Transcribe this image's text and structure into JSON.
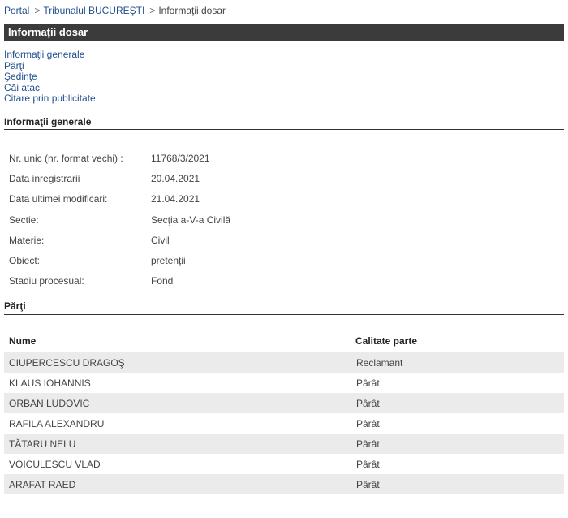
{
  "breadcrumb": {
    "portal": "Portal",
    "sep": ">",
    "court": "Tribunalul BUCUREŞTI",
    "current": "Informaţii dosar"
  },
  "page_title": "Informaţii dosar",
  "anchor_links": [
    "Informaţii generale",
    "Părţi",
    "Şedinţe",
    "Căi atac",
    "Citare prin publicitate"
  ],
  "general": {
    "heading": "Informaţii generale",
    "rows": [
      {
        "label": "Nr. unic (nr. format vechi) :",
        "value": "11768/3/2021"
      },
      {
        "label": "Data inregistrarii",
        "value": "20.04.2021"
      },
      {
        "label": "Data ultimei modificari:",
        "value": "21.04.2021"
      },
      {
        "label": "Sectie:",
        "value": "Secţia a-V-a Civilă"
      },
      {
        "label": "Materie:",
        "value": "Civil"
      },
      {
        "label": "Obiect:",
        "value": "pretenţii"
      },
      {
        "label": "Stadiu procesual:",
        "value": "Fond"
      }
    ]
  },
  "parti": {
    "heading": "Părţi",
    "columns": {
      "name": "Nume",
      "role": "Calitate parte"
    },
    "rows": [
      {
        "name": "CIUPERCESCU DRAGOŞ",
        "role": "Reclamant"
      },
      {
        "name": "KLAUS IOHANNIS",
        "role": "Pârât"
      },
      {
        "name": "ORBAN LUDOVIC",
        "role": "Pârât"
      },
      {
        "name": "RAFILA ALEXANDRU",
        "role": "Pârât"
      },
      {
        "name": "TĂTARU NELU",
        "role": "Pârât"
      },
      {
        "name": "VOICULESCU VLAD",
        "role": "Pârât"
      },
      {
        "name": "ARAFAT RAED",
        "role": "Pârât"
      }
    ]
  }
}
